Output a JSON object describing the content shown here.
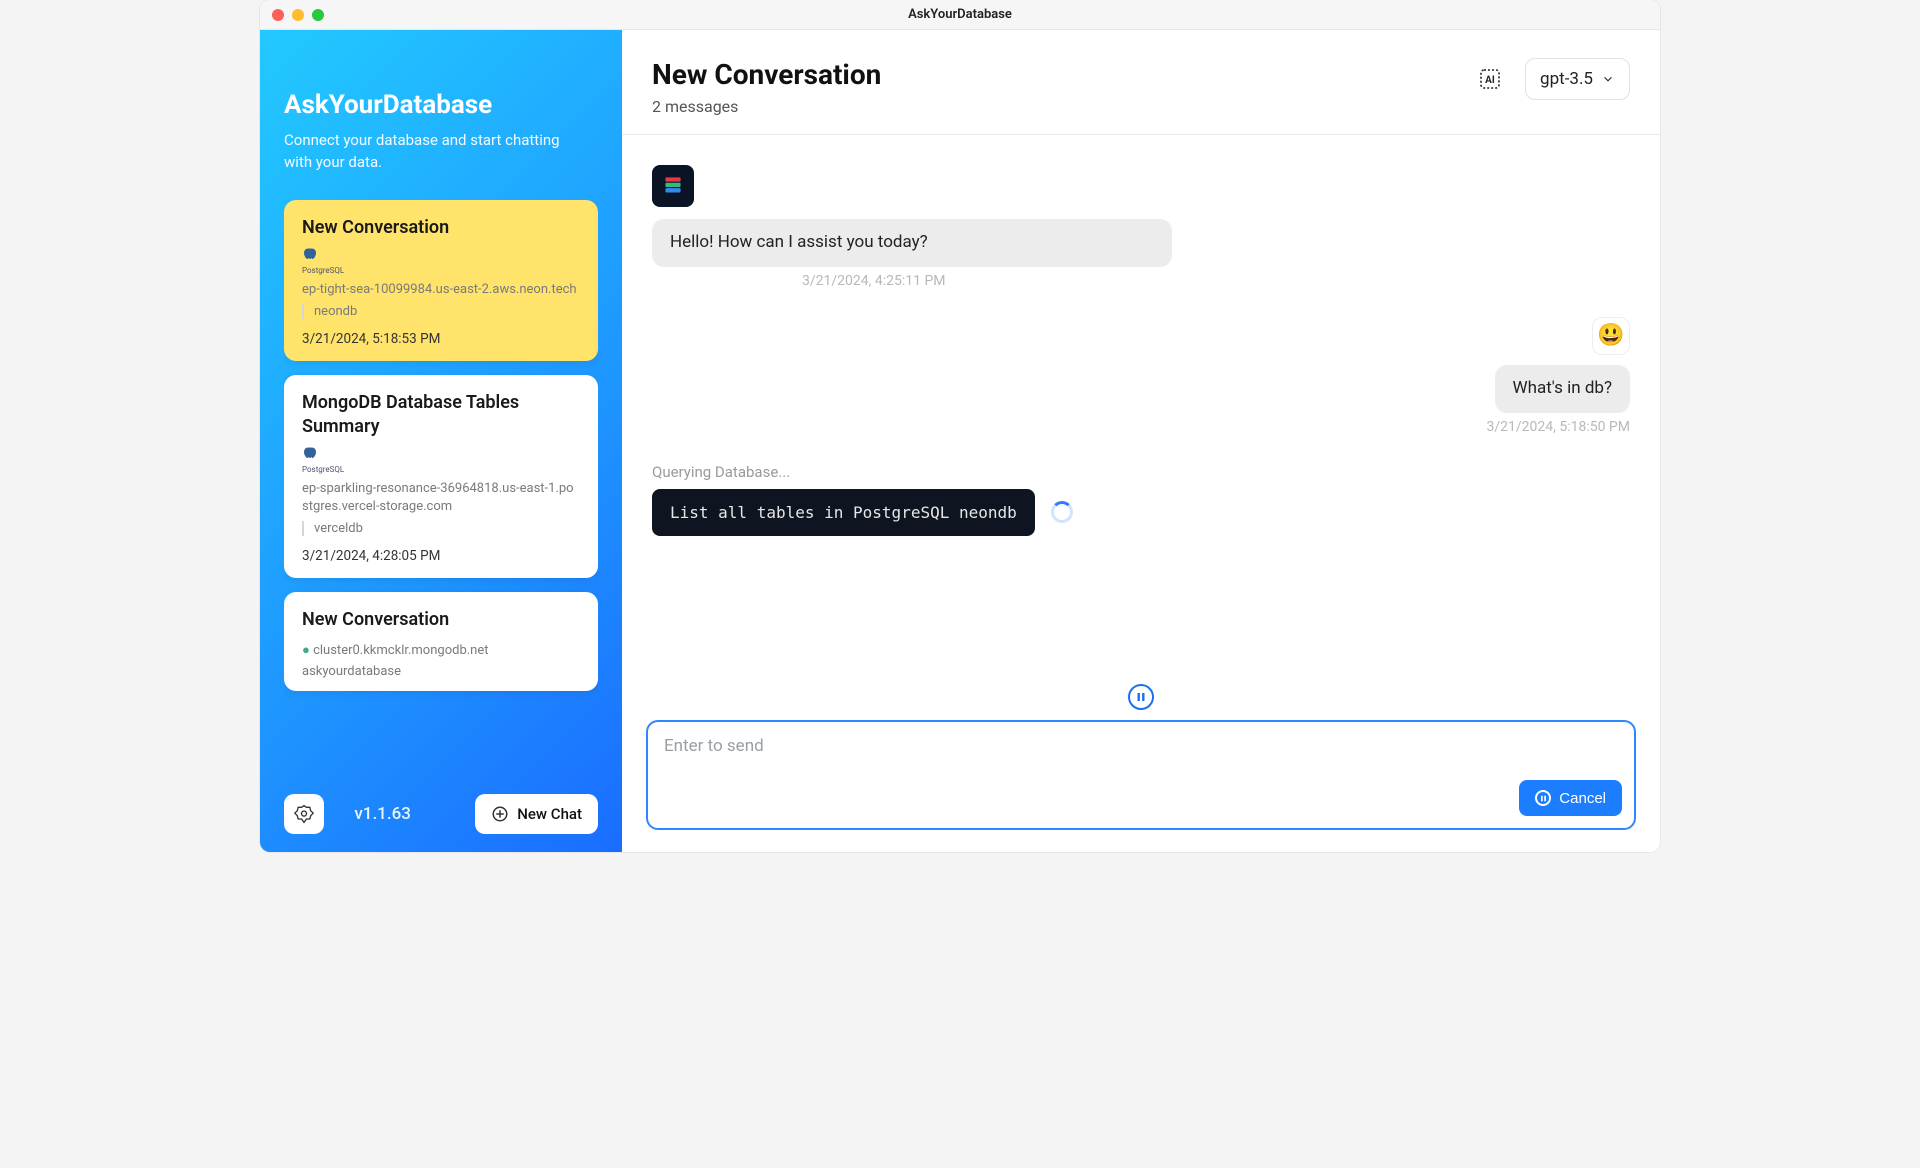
{
  "window": {
    "title": "AskYourDatabase"
  },
  "sidebar": {
    "brand": "AskYourDatabase",
    "tagline": "Connect your database and start chatting with your data.",
    "version": "v1.1.63",
    "new_chat_label": "New Chat",
    "items": [
      {
        "title": "New Conversation",
        "db_engine": "PostgreSQL",
        "host": "ep-tight-sea-10099984.us-east-2.aws.neon.tech",
        "dbname": "neondb",
        "timestamp": "3/21/2024, 5:18:53 PM",
        "active": true
      },
      {
        "title": "MongoDB Database Tables Summary",
        "db_engine": "PostgreSQL",
        "host": "ep-sparkling-resonance-36964818.us-east-1.postgres.vercel-storage.com",
        "dbname": "verceldb",
        "timestamp": "3/21/2024, 4:28:05 PM",
        "active": false
      },
      {
        "title": "New Conversation",
        "db_engine": "MongoDB",
        "host": "cluster0.kkmcklr.mongodb.net",
        "dbname": "askyourdatabase",
        "timestamp": "",
        "active": false
      }
    ]
  },
  "header": {
    "title": "New Conversation",
    "subtitle": "2 messages",
    "model_label": "gpt-3.5",
    "ai_icon_label": "AI"
  },
  "messages": {
    "bot_greeting": "Hello! How can I assist you today?",
    "bot_greeting_time": "3/21/2024, 4:25:11 PM",
    "user_q": "What's in db?",
    "user_q_time": "3/21/2024, 5:18:50 PM",
    "query_status": "Querying Database...",
    "query_code": "List all tables in PostgreSQL neondb",
    "user_emoji": "😃"
  },
  "composer": {
    "placeholder": "Enter to send",
    "cancel_label": "Cancel"
  }
}
